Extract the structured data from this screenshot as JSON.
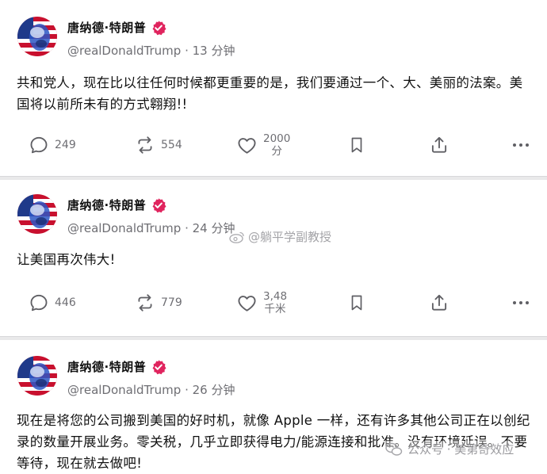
{
  "posts": [
    {
      "author_name": "唐纳德·特朗普",
      "handle": "@realDonaldTrump",
      "time": "· 13 分钟",
      "text": "共和党人，现在比以往任何时候都更重要的是，我们要通过一个、大、美丽的法案。美国将以前所未有的方式翱翔!!",
      "reply_count": "249",
      "repost_count": "554",
      "like_count_line1": "2000",
      "like_count_line2": "分"
    },
    {
      "author_name": "唐纳德·特朗普",
      "handle": "@realDonaldTrump",
      "time": "· 24 分钟",
      "text": "让美国再次伟大!",
      "reply_count": "446",
      "repost_count": "779",
      "like_count_line1": "3,48",
      "like_count_line2": "千米"
    },
    {
      "author_name": "唐纳德·特朗普",
      "handle": "@realDonaldTrump",
      "time": "· 26 分钟",
      "text": "现在是将您的公司搬到美国的好时机，就像 Apple 一样，还有许多其他公司正在以创纪录的数量开展业务。零关税，几乎立即获得电力/能源连接和批准。没有环境延误。不要等待，现在就去做吧!"
    }
  ],
  "watermarks": {
    "weibo": "@躺平学副教授",
    "wechat": "公众号 · 美第奇效应"
  },
  "colors": {
    "verified_badge": "#e0245e",
    "secondary_text": "#6e6e73",
    "divider": "#e9e9ea"
  },
  "icons": [
    "reply-icon",
    "repost-icon",
    "like-icon",
    "bookmark-icon",
    "share-icon",
    "more-icon",
    "verified-badge-icon"
  ]
}
